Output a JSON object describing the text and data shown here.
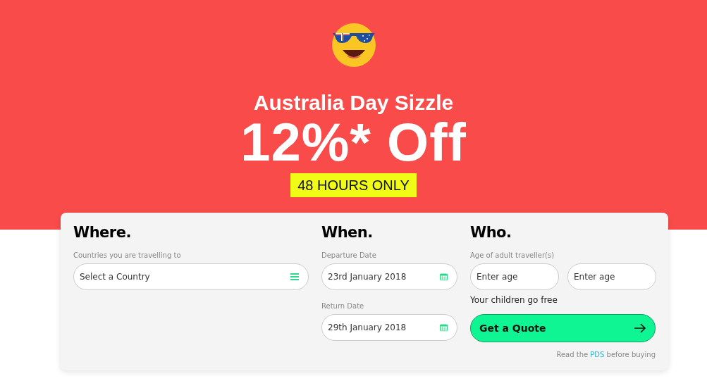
{
  "hero": {
    "title": "Australia Day Sizzle",
    "offer": "12%* Off",
    "badge": "48 HOURS ONLY"
  },
  "where": {
    "heading": "Where.",
    "label": "Countries you are travelling to",
    "placeholder": "Select a Country"
  },
  "when": {
    "heading": "When.",
    "fields": [
      {
        "label": "Departure Date",
        "value": "23rd January 2018"
      },
      {
        "label": "Return Date",
        "value": "29th January 2018"
      }
    ]
  },
  "who": {
    "heading": "Who.",
    "label": "Age of adult traveller(s)",
    "ages": [
      {
        "placeholder": "Enter age"
      },
      {
        "placeholder": "Enter age"
      }
    ],
    "note": "Your children go free",
    "button": "Get a Quote"
  },
  "footer": {
    "before": "Read the",
    "link": "PDS",
    "after": "before buying"
  }
}
